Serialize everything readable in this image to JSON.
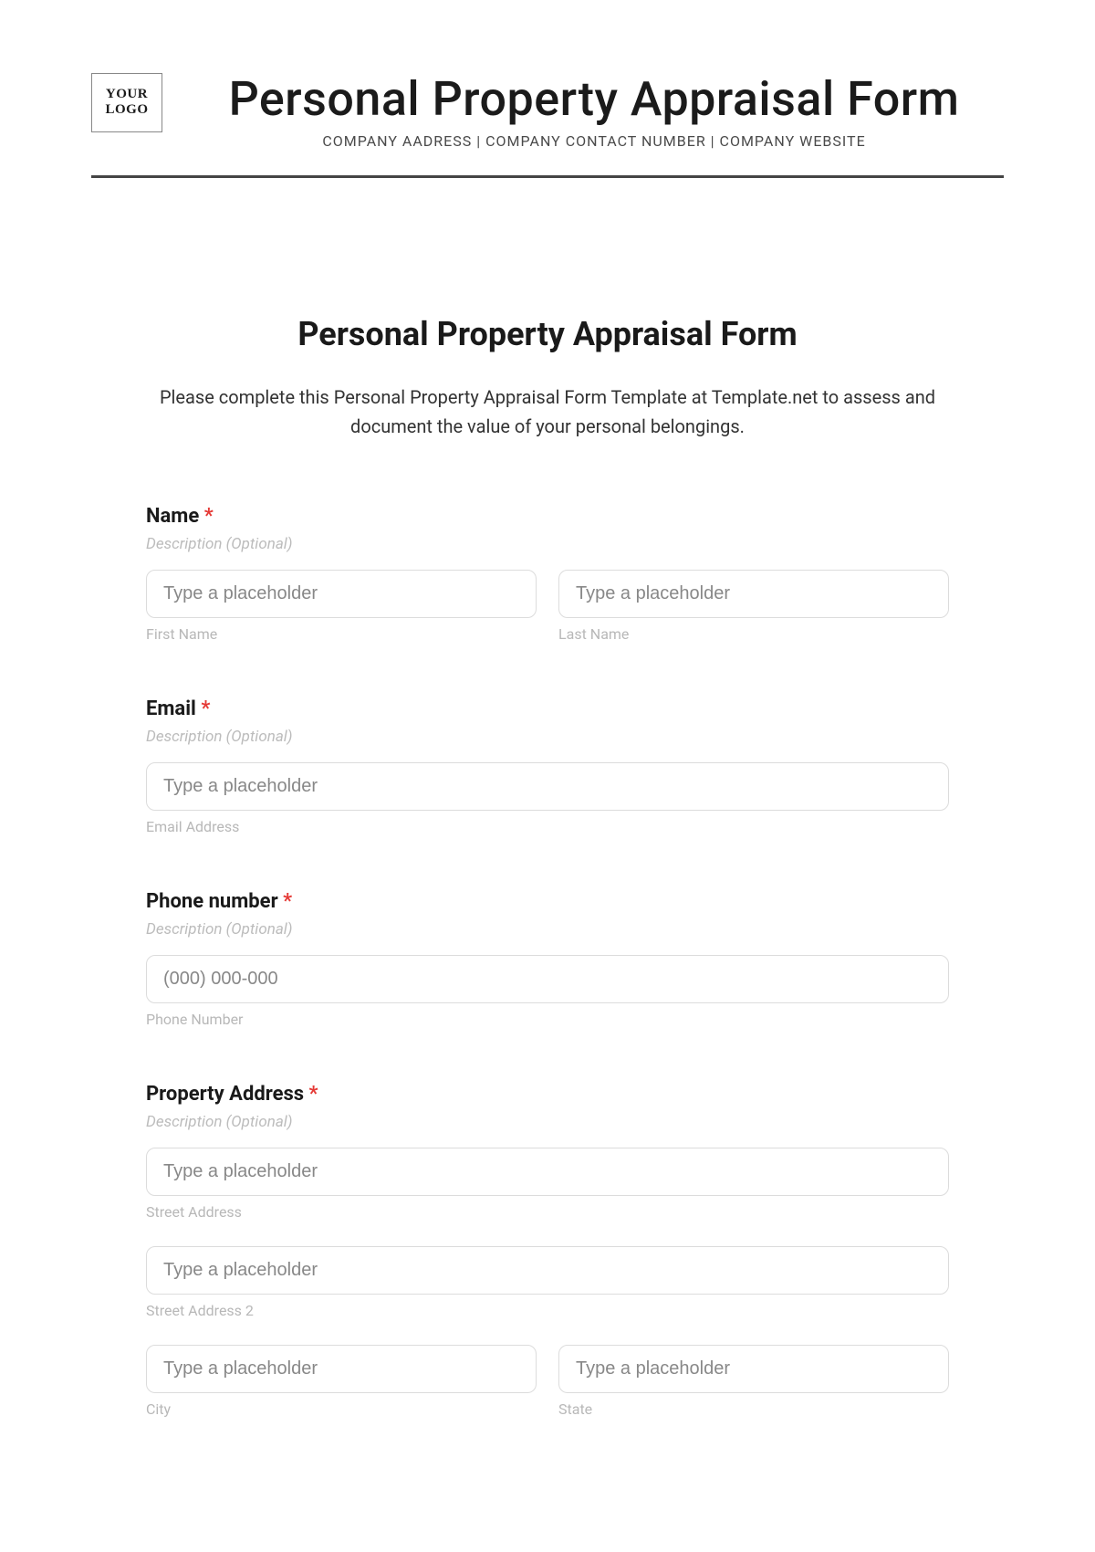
{
  "header": {
    "logo_line1": "YOUR",
    "logo_line2": "LOGO",
    "title": "Personal Property Appraisal Form",
    "subtitle": "COMPANY AADRESS | COMPANY CONTACT NUMBER | COMPANY WEBSITE"
  },
  "form": {
    "title": "Personal Property Appraisal Form",
    "intro": "Please complete this Personal Property Appraisal Form Template at Template.net to assess and document the value of your personal belongings.",
    "required_mark": "*",
    "desc_optional": "Description (Optional)",
    "placeholder_generic": "Type a placeholder",
    "sections": {
      "name": {
        "label": "Name",
        "first_sub": "First Name",
        "last_sub": "Last Name"
      },
      "email": {
        "label": "Email",
        "sub": "Email Address"
      },
      "phone": {
        "label": "Phone number",
        "placeholder": "(000) 000-000",
        "sub": "Phone Number"
      },
      "address": {
        "label": "Property Address",
        "street_sub": "Street Address",
        "street2_sub": "Street Address 2",
        "city_sub": "City",
        "state_sub": "State"
      }
    }
  }
}
